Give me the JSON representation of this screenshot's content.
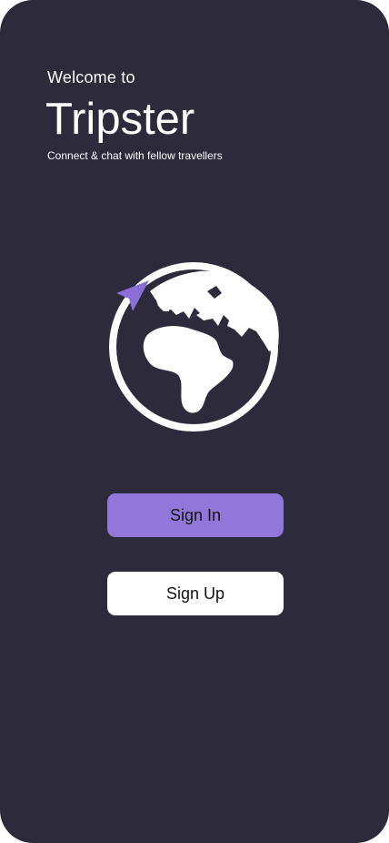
{
  "welcome_text": "Welcome to",
  "app_name": "Tripster",
  "tagline": "Connect & chat with fellow travellers",
  "logo": {
    "icon": "globe-with-plane-icon",
    "accent_color": "#8b6fd6",
    "icon_color": "#ffffff"
  },
  "buttons": {
    "sign_in": "Sign In",
    "sign_up": "Sign Up"
  },
  "colors": {
    "background": "#2c2a3b",
    "primary_button": "#9177da",
    "secondary_button": "#ffffff"
  }
}
